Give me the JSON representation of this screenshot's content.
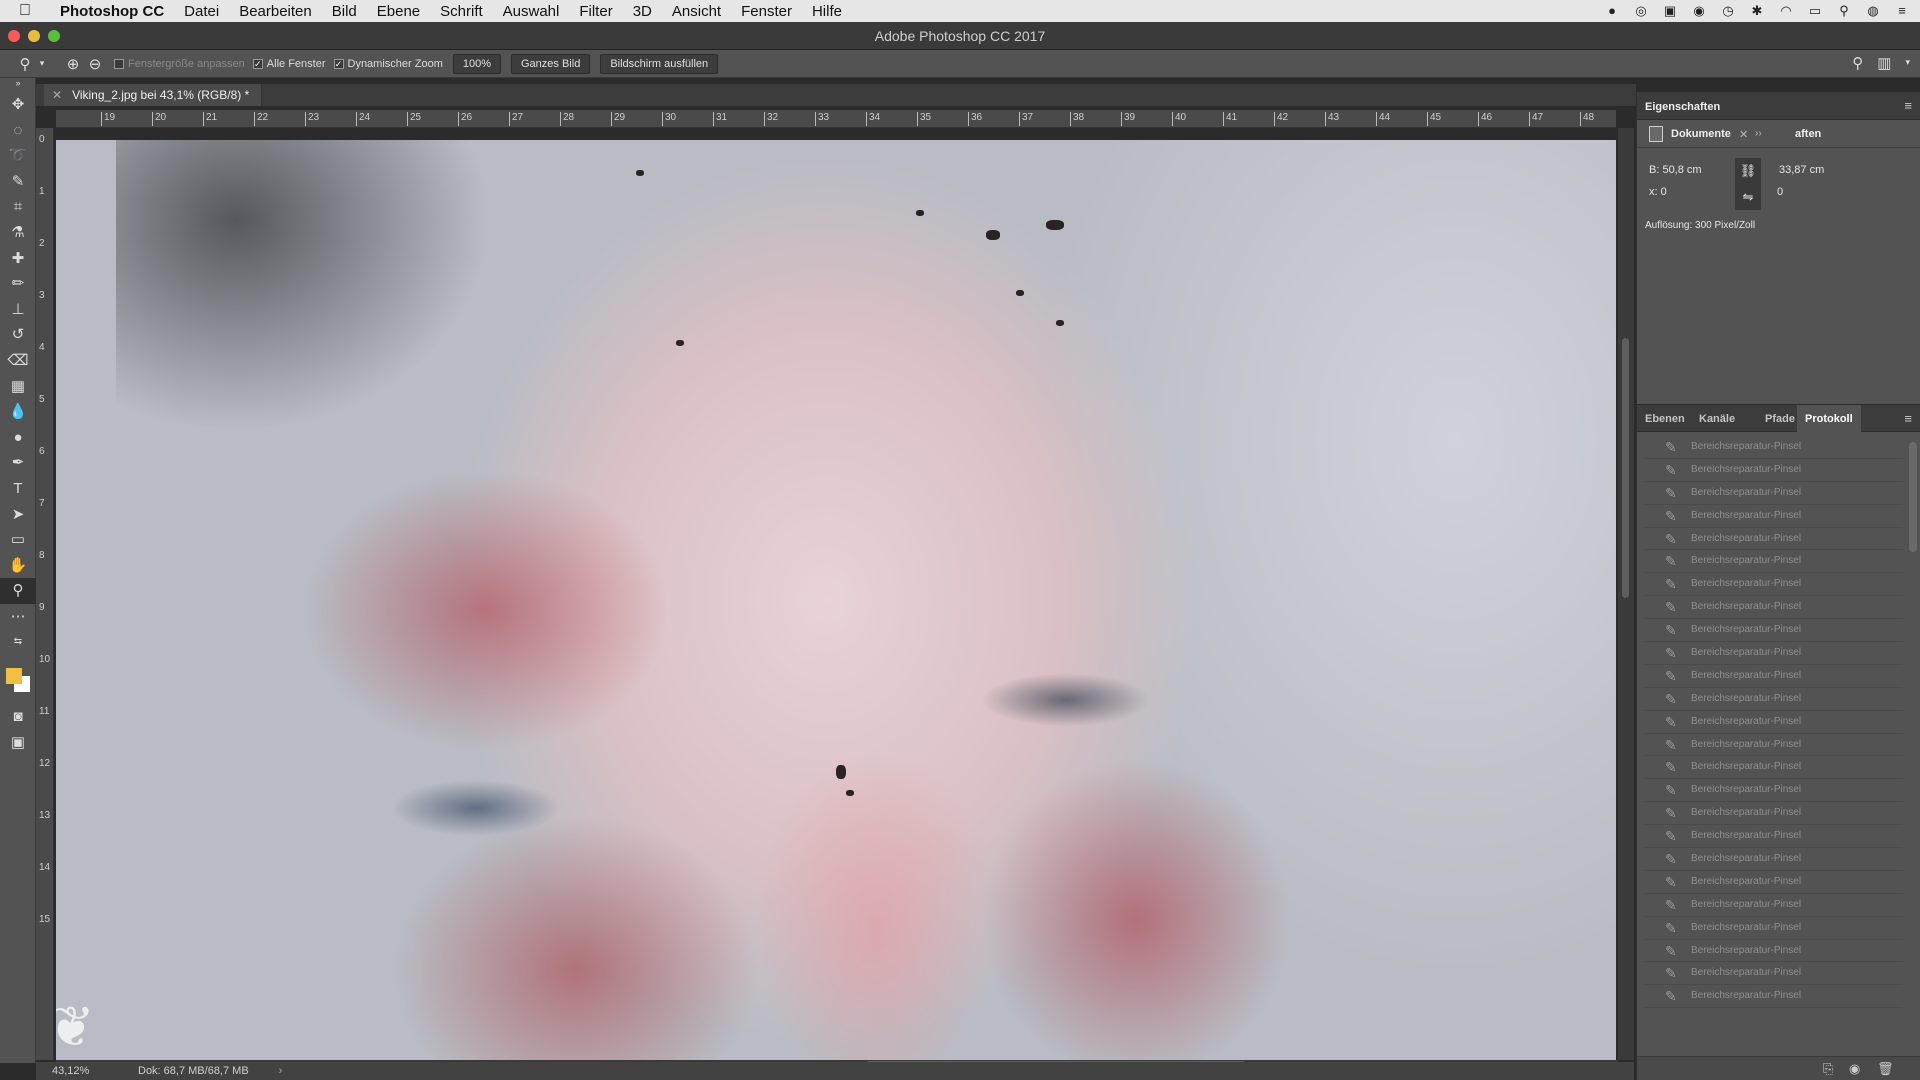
{
  "menubar": {
    "app": "Photoshop CC",
    "items": [
      "Datei",
      "Bearbeiten",
      "Bild",
      "Ebene",
      "Schrift",
      "Auswahl",
      "Filter",
      "3D",
      "Ansicht",
      "Fenster",
      "Hilfe"
    ]
  },
  "window": {
    "title": "Adobe Photoshop CC 2017"
  },
  "options": {
    "fit_window": "Fenstergröße anpassen",
    "all_windows": "Alle Fenster",
    "dynamic_zoom": "Dynamischer Zoom",
    "zoom_value": "100%",
    "fit_screen": "Ganzes Bild",
    "fill_screen": "Bildschirm ausfüllen"
  },
  "document": {
    "tab_title": "Viking_2.jpg bei 43,1% (RGB/8) *"
  },
  "rulers": {
    "h_ticks": [
      "19",
      "20",
      "21",
      "22",
      "23",
      "24",
      "25",
      "26",
      "27",
      "28",
      "29",
      "30",
      "31",
      "32",
      "33",
      "34",
      "35",
      "36",
      "37",
      "38",
      "39",
      "40",
      "41",
      "42",
      "43",
      "44",
      "45",
      "46",
      "47",
      "48"
    ],
    "v_ticks": [
      "0",
      "1",
      "2",
      "3",
      "4",
      "5",
      "6",
      "7",
      "8",
      "9",
      "10",
      "11",
      "12",
      "13",
      "14",
      "15"
    ]
  },
  "status": {
    "zoom": "43,12%",
    "doc_size": "Dok: 68,7 MB/68,7 MB",
    "arrow": "›"
  },
  "properties": {
    "title": "Eigenschaften",
    "sub_label": "Dokumente",
    "sub_label_cut": "aften",
    "width": "B: 50,8 cm",
    "height": "33,87 cm",
    "x": "x: 0",
    "y": "0",
    "resolution": "Auflösung: 300 Pixel/Zoll"
  },
  "layers_tabs": {
    "tabs": [
      "Ebenen",
      "Kanäle",
      "Pfade",
      "Protokoll"
    ],
    "active": "Protokoll"
  },
  "history": {
    "item_label": "Bereichsreparatur-Pinsel",
    "items": [
      "Bereichsreparatur-Pinsel",
      "Bereichsreparatur-Pinsel",
      "Bereichsreparatur-Pinsel",
      "Bereichsreparatur-Pinsel",
      "Bereichsreparatur-Pinsel",
      "Bereichsreparatur-Pinsel",
      "Bereichsreparatur-Pinsel",
      "Bereichsreparatur-Pinsel",
      "Bereichsreparatur-Pinsel",
      "Bereichsreparatur-Pinsel",
      "Bereichsreparatur-Pinsel",
      "Bereichsreparatur-Pinsel",
      "Bereichsreparatur-Pinsel",
      "Bereichsreparatur-Pinsel",
      "Bereichsreparatur-Pinsel",
      "Bereichsreparatur-Pinsel",
      "Bereichsreparatur-Pinsel",
      "Bereichsreparatur-Pinsel",
      "Bereichsreparatur-Pinsel",
      "Bereichsreparatur-Pinsel",
      "Bereichsreparatur-Pinsel",
      "Bereichsreparatur-Pinsel",
      "Bereichsreparatur-Pinsel",
      "Bereichsreparatur-Pinsel",
      "Bereichsreparatur-Pinsel"
    ]
  },
  "colors": {
    "foreground": "#f0c040",
    "background": "#ffffff"
  }
}
